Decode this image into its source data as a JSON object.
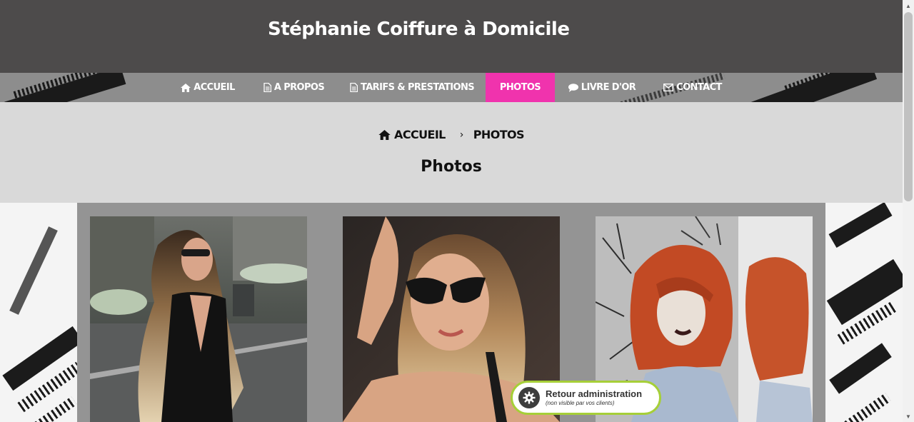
{
  "site": {
    "title": "Stéphanie Coiffure à Domicile"
  },
  "nav": {
    "items": [
      {
        "label": "ACCUEIL",
        "icon": "home-icon"
      },
      {
        "label": "A PROPOS",
        "icon": "document-icon"
      },
      {
        "label": "TARIFS & PRESTATIONS",
        "icon": "document-icon"
      },
      {
        "label": "PHOTOS",
        "icon": "",
        "active": true
      },
      {
        "label": "LIVRE D'OR",
        "icon": "speech-bubble-icon"
      },
      {
        "label": "CONTACT",
        "icon": "envelope-icon"
      }
    ],
    "active_color": "#f033ad"
  },
  "breadcrumb": {
    "home": "ACCUEIL",
    "separator": "›",
    "current": "PHOTOS"
  },
  "page": {
    "title": "Photos"
  },
  "gallery": {
    "photos": [
      {
        "name": "photo-blonde-wavy-hair-sunglasses"
      },
      {
        "name": "photo-woman-cat-eye-sunglasses"
      },
      {
        "name": "photo-red-bob-haircut"
      }
    ]
  },
  "admin": {
    "label": "Retour administration",
    "note": "(non visible par vos clients)",
    "icon": "gear-icon",
    "border_color": "#a6cf38"
  },
  "colors": {
    "header": "#4d4b4b",
    "nav": "#8d8d8d",
    "breadcrumb_band": "#d9d9d9",
    "gallery_bg": "#949494"
  }
}
